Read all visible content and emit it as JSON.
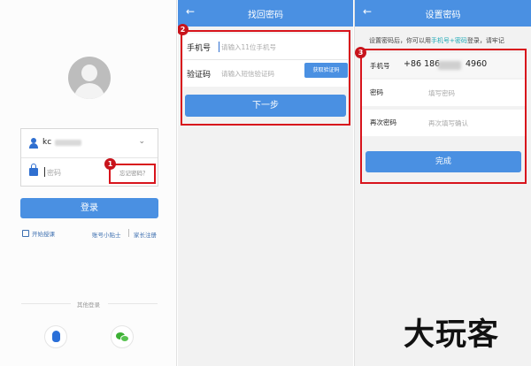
{
  "login": {
    "account_prefix": "kc",
    "password_placeholder": "密码",
    "forgot_label": "忘记密码？",
    "login_button": "登录",
    "teach_link": "开始授课",
    "helper_link": "账号小贴士",
    "parent_register": "家长注册",
    "other_login": "其他登录",
    "badge": "1"
  },
  "find_password": {
    "title": "找回密码",
    "phone_label": "手机号",
    "phone_placeholder": "请输入11位手机号",
    "code_label": "验证码",
    "code_placeholder": "请输入短信验证码",
    "get_code_button": "获取验证码",
    "next_button": "下一步",
    "badge": "2"
  },
  "set_password": {
    "title": "设置密码",
    "hint_before": "设置密码后，你可以用",
    "hint_highlight": "手机号+密码",
    "hint_after": "登录，请牢记",
    "phone_label": "手机号",
    "phone_prefix": "+86  186",
    "phone_suffix": "4960",
    "password_label": "密码",
    "password_placeholder": "填写密码",
    "confirm_label": "再次密码",
    "confirm_placeholder": "再次填写确认",
    "done_button": "完成",
    "badge": "3"
  },
  "watermark": "大玩客",
  "colors": {
    "accent": "#4a90e2",
    "highlight": "#d8141c"
  }
}
